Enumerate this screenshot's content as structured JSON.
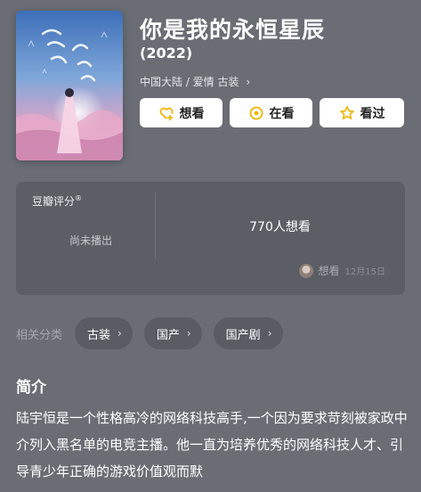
{
  "movie": {
    "title": "你是我的永恒星辰",
    "year": "(2022)",
    "meta": "中国大陆 / 爱情  古装",
    "meta_chevron": "›",
    "poster_alt": "poster"
  },
  "actions": [
    {
      "label": "想看",
      "icon": "heart-plus-icon"
    },
    {
      "label": "在看",
      "icon": "target-icon"
    },
    {
      "label": "看过",
      "icon": "star-icon"
    }
  ],
  "rating": {
    "label": "豆瓣评分",
    "label_mark": "®",
    "status": "尚未播出",
    "wish_count": "770人想看",
    "recent_action": "想看",
    "recent_date": "12月15日"
  },
  "tags": {
    "label": "相关分类",
    "items": [
      "古装",
      "国产",
      "国产剧"
    ],
    "chevron": "›"
  },
  "summary": {
    "title": "简介",
    "text": "陆宇恒是一个性格高冷的网络科技高手,一个因为要求苛刻被家政中介列入黑名单的电竞主播。他一直为培养优秀的网络科技人才、引导青少年正确的游戏价值观而默"
  },
  "colors": {
    "background": "#6a6d74",
    "card": "#5b5e65",
    "button": "#ffffff",
    "accent": "#f0b400"
  }
}
